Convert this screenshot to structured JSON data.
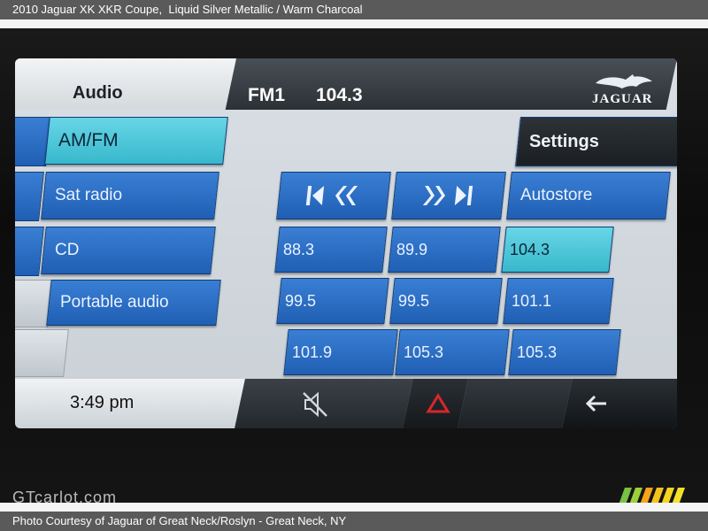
{
  "caption": {
    "title": "2010 Jaguar XK XKR Coupe,",
    "color_spec": "  Liquid Silver Metallic / Warm Charcoal",
    "credit": "Photo Courtesy of Jaguar of Great Neck/Roslyn - Great Neck, NY"
  },
  "watermark": "GTcarlot.com",
  "header": {
    "section": "Audio",
    "band": "FM1",
    "frequency": "104.3",
    "brand": "JAGUAR"
  },
  "sources": [
    {
      "label": "AM/FM",
      "active": true
    },
    {
      "label": "Sat radio",
      "active": false
    },
    {
      "label": "CD",
      "active": false
    },
    {
      "label": "Portable audio",
      "active": false
    }
  ],
  "controls": {
    "settings": "Settings",
    "autostore": "Autostore",
    "seek_back_icon": "seek-back-icon",
    "seek_forward_icon": "seek-forward-icon"
  },
  "presets": [
    "88.3",
    "89.9",
    "104.3",
    "99.5",
    "99.5",
    "101.1",
    "101.9",
    "105.3",
    "105.3"
  ],
  "active_preset": "104.3",
  "footer": {
    "time": "3:49  pm",
    "icons": [
      "mute-icon",
      "hazard-icon",
      "back-arrow-icon"
    ]
  },
  "colors": {
    "button_blue": "#2a6fc8",
    "active_cyan": "#4ec8da",
    "hazard_red": "#d8262a"
  }
}
